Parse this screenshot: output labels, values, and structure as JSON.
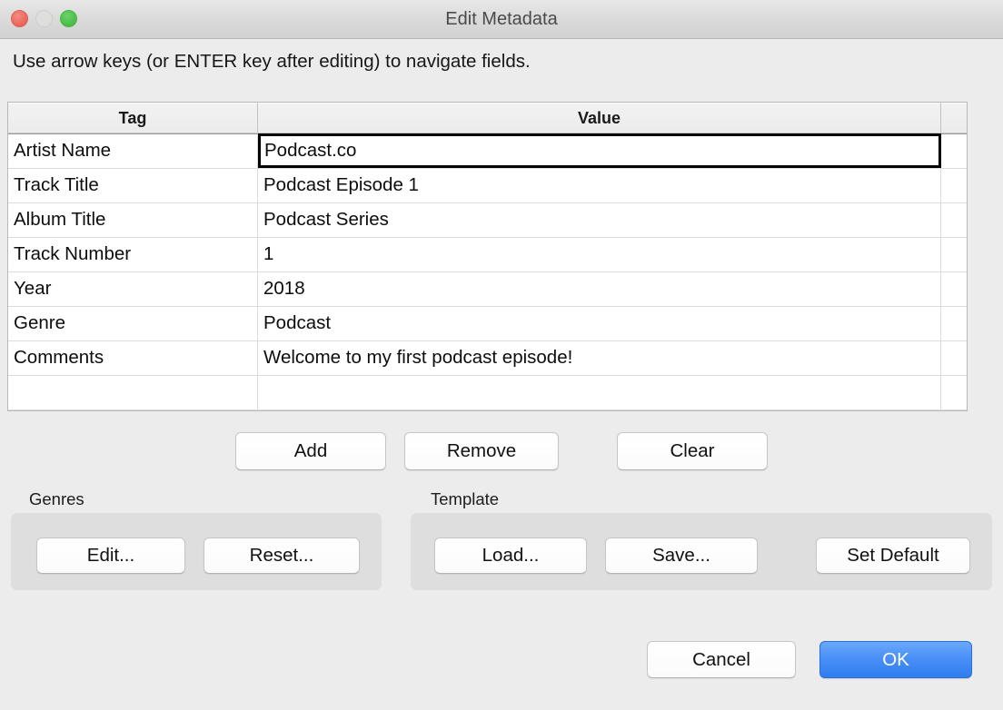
{
  "window": {
    "title": "Edit Metadata",
    "traffic_lights": {
      "close": "close-button",
      "minimize": "minimize-button",
      "zoom": "zoom-button"
    },
    "colors": {
      "background": "#ececec",
      "titlebar": "#d9d9d9",
      "close": "#ed6a5e",
      "minimize": "#dededc",
      "zoom": "#4cc04a",
      "default_button": "#2f7df0",
      "group_box": "#dedede"
    }
  },
  "instruction": "Use arrow keys (or ENTER key after editing) to navigate fields.",
  "table": {
    "headers": [
      "Tag",
      "Value",
      ""
    ],
    "rows": [
      {
        "tag": "Artist Name",
        "value": "Podcast.co",
        "focused": true
      },
      {
        "tag": "Track Title",
        "value": "Podcast Episode 1",
        "focused": false
      },
      {
        "tag": "Album Title",
        "value": "Podcast Series",
        "focused": false
      },
      {
        "tag": "Track Number",
        "value": "1",
        "focused": false
      },
      {
        "tag": "Year",
        "value": "2018",
        "focused": false
      },
      {
        "tag": "Genre",
        "value": "Podcast",
        "focused": false
      },
      {
        "tag": "Comments",
        "value": "Welcome to my first podcast episode!",
        "focused": false
      },
      {
        "tag": "",
        "value": "",
        "focused": false
      }
    ]
  },
  "row_buttons": {
    "add": "Add",
    "remove": "Remove",
    "clear": "Clear"
  },
  "genres": {
    "label": "Genres",
    "edit": "Edit...",
    "reset": "Reset..."
  },
  "template": {
    "label": "Template",
    "load": "Load...",
    "save": "Save...",
    "set_default": "Set Default"
  },
  "footer": {
    "cancel": "Cancel",
    "ok": "OK"
  }
}
